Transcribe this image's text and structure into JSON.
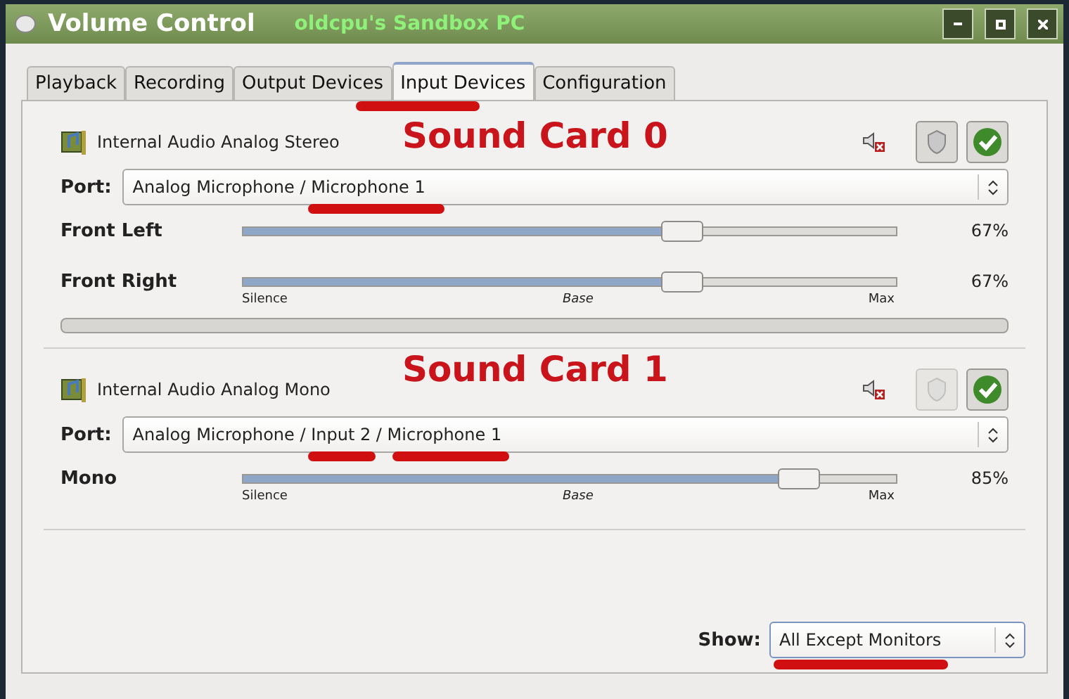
{
  "window": {
    "title": "Volume Control",
    "subtitle": "oldcpu's Sandbox PC"
  },
  "tabs": [
    {
      "label": "Playback",
      "selected": false
    },
    {
      "label": "Recording",
      "selected": false
    },
    {
      "label": "Output Devices",
      "selected": false
    },
    {
      "label": "Input Devices",
      "selected": true
    },
    {
      "label": "Configuration",
      "selected": false
    }
  ],
  "cards": [
    {
      "name": "Internal Audio Analog Stereo",
      "annotation": "Sound Card 0",
      "lock_disabled": false,
      "port_label": "Port:",
      "port": "Analog Microphone / Microphone 1",
      "channels": [
        {
          "name": "Front Left",
          "level": 0.67,
          "reading": "67%"
        },
        {
          "name": "Front Right",
          "level": 0.67,
          "reading": "67%"
        }
      ],
      "scale": [
        "Silence",
        "Base",
        "Max"
      ],
      "meter": true
    },
    {
      "name": "Internal Audio Analog Mono",
      "annotation": "Sound Card 1",
      "lock_disabled": true,
      "port_label": "Port:",
      "port": "Analog Microphone / Input 2 / Microphone 1",
      "channels": [
        {
          "name": "Mono",
          "level": 0.85,
          "reading": "85%"
        }
      ],
      "scale": [
        "Silence",
        "Base",
        "Max"
      ]
    }
  ],
  "show": {
    "label": "Show:",
    "value": "All Except Monitors"
  }
}
